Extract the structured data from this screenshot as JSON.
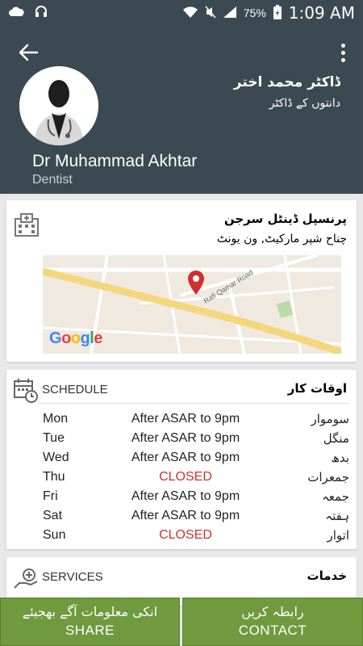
{
  "status_bar": {
    "battery": "75%",
    "time": "1:09 AM",
    "icons": [
      "cloud-icon",
      "headphones-icon",
      "wifi-icon",
      "mute-icon",
      "signal-icon",
      "battery-icon"
    ]
  },
  "header": {
    "name_urdu": "ڈاکٹر محمد اختر",
    "title_urdu": "دانتوں کے ڈاکٹر",
    "name": "Dr Muhammad Akhtar",
    "title": "Dentist",
    "bg_color": "#3b4a52"
  },
  "clinic": {
    "name": "پرنسپل ڈینٹل سرجن",
    "address": "چناح شپر مارکیٹ, ون یونٹ",
    "map_street": "Rafi Qamar Road",
    "map_logo": "Google"
  },
  "schedule": {
    "title": "SCHEDULE",
    "title_urdu": "اوقات کار",
    "rows": [
      {
        "day": "Mon",
        "time": "After ASAR to 9pm",
        "day_urdu": "سوموار",
        "closed": false
      },
      {
        "day": "Tue",
        "time": "After ASAR to 9pm",
        "day_urdu": "منگل",
        "closed": false
      },
      {
        "day": "Wed",
        "time": "After ASAR to 9pm",
        "day_urdu": "بدھ",
        "closed": false
      },
      {
        "day": "Thu",
        "time": "CLOSED",
        "day_urdu": "جمعرات",
        "closed": true
      },
      {
        "day": "Fri",
        "time": "After ASAR to 9pm",
        "day_urdu": "جمعہ",
        "closed": false
      },
      {
        "day": "Sat",
        "time": "After ASAR to 9pm",
        "day_urdu": "ہفتہ",
        "closed": false
      },
      {
        "day": "Sun",
        "time": "CLOSED",
        "day_urdu": "اتوار",
        "closed": true
      }
    ]
  },
  "services": {
    "title": "SERVICES",
    "title_urdu": "خدمات"
  },
  "buttons": {
    "share_urdu": "انکی معلومات آگے بھجیئے",
    "share": "SHARE",
    "contact_urdu": "رابطہ کریں",
    "contact": "CONTACT",
    "color": "#6f9a3e"
  }
}
